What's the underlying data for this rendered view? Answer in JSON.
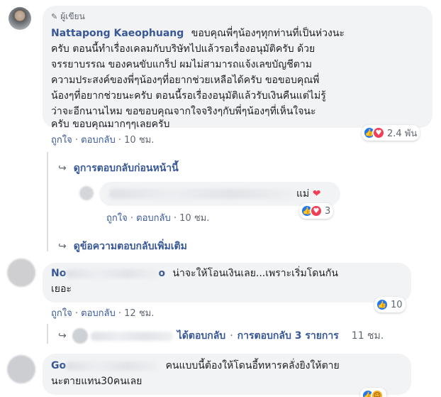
{
  "comments": [
    {
      "author_badge": "ผู้เขียน",
      "author": "Nattapong Kaeophuang",
      "text_lines": [
        "ขอบคุณพี่ๆน้องๆทุกท่านที่เป็นห่วงนะ",
        "ครับ ตอนนี้ทำเรื่องเคลมกับบริษัทไปแล้วรอเรื่องอนุมัติครับ ด้วย",
        "จรรยาบรรณ ของคนขับแกร็ป ผมไม่สามารถแจ้งเลขบัญชีตาม",
        "ความประสงค์ของพี่ๆน้องๆที่อยากช่วยเหลือได้ครับ ขอขอบคุณพี่",
        "น้องๆที่อยากช่วยนะครับ ตอนนี้รอเรื่องอนุมัติแล้วรับเงินคืนแต่ไม่รู้",
        "ว่าจะอีกนานไหม ขอขอบคุณจากใจจริงๆกับพี่ๆน้องๆที่เห็นใจนะ",
        "ครับ ขอบคุณมากๆๆเลยครับ"
      ],
      "like": "ถูกใจ",
      "reply": "ตอบกลับ",
      "time": "10 ชม.",
      "reactions": [
        "like",
        "love"
      ],
      "reaction_count": "2.4 พัน"
    },
    {
      "author": "No",
      "author_suffix": "o",
      "text_lines": [
        "น่าจะให้โอนเงินเลย...เพราะเริ่มโดนกัน",
        "เยอะ"
      ],
      "like": "ถูกใจ",
      "reply": "ตอบกลับ",
      "time": "12 ชม.",
      "reactions": [
        "like"
      ],
      "reaction_count": "10"
    },
    {
      "author": "Go",
      "text_lines": [
        "คนแบบนี้ต้องให้โดนอี้ทหารคลั่งยิงให้ตาย",
        "นะตายแทน30คนเลย"
      ],
      "reactions": [
        "like",
        "haha"
      ]
    }
  ],
  "previous_replies_link": "ดูการตอบกลับก่อนหน้านี้",
  "nested_reply": {
    "text": "แม่",
    "emoji": "❤",
    "like": "ถูกใจ",
    "reply": "ตอบกลับ",
    "time": "10 ชม.",
    "reactions": [
      "like",
      "love"
    ],
    "reaction_count": "3"
  },
  "more_replies_link": "ดูข้อความตอบกลับเพิ่มเติม",
  "replied_summary": {
    "replied": "ได้ตอบกลับ",
    "count": "การตอบกลับ 3 รายการ",
    "time": "11 ชม."
  },
  "separator": "·",
  "icons": {
    "reply_arrow": "↪",
    "author_badge": "pen-icon"
  },
  "colors": {
    "link": "#385898",
    "like": "#2078f4",
    "love": "#f33e58",
    "haha": "#f7b125"
  }
}
